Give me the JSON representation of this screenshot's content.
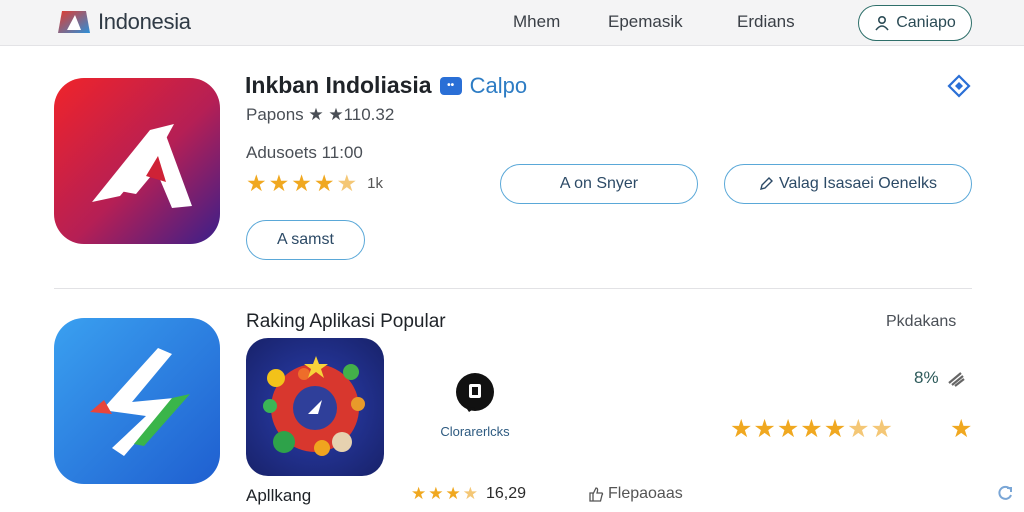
{
  "header": {
    "brand": "Indonesia",
    "nav": [
      "Mhem",
      "Epemasik",
      "Erdians"
    ],
    "signin_label": "Caniapo"
  },
  "app": {
    "title": "Inkban Indoliasia",
    "developer": "Calpo",
    "subtitle": "Papons ★ ★110.32",
    "meta": "Adusoets 11:00",
    "rating_count": "1k",
    "buttons": {
      "primary": "A on Snyer",
      "secondary": "Valag Isasaei Oenelks",
      "tertiary": "A samst"
    }
  },
  "ranking": {
    "title": "Raking Aplikasi Popular",
    "more": "Pkdakans",
    "game_name": "Apllkang",
    "mini_app_label": "Clorarerlcks",
    "percent": "8%",
    "bottom_rating_value": "16,29",
    "bottom_link": "Flepaoaas"
  },
  "colors": {
    "accent": "#2a6fd6",
    "star": "#f0a820",
    "outline": "#5aa8d8"
  }
}
